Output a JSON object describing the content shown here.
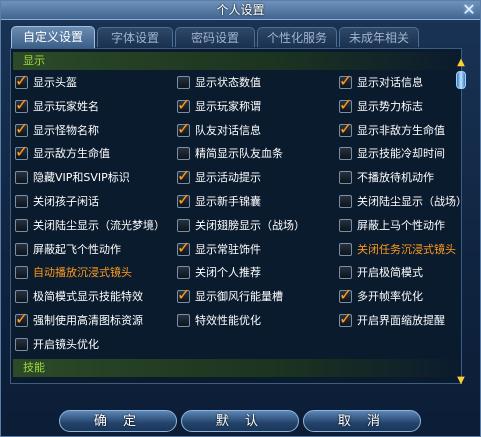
{
  "window": {
    "title": "个人设置"
  },
  "tabs": [
    "自定义设置",
    "字体设置",
    "密码设置",
    "个性化服务",
    "未成年相关"
  ],
  "sections": {
    "display": "显示",
    "skills": "技能"
  },
  "options": [
    [
      {
        "label": "显示头盔",
        "checked": true
      },
      {
        "label": "显示状态数值",
        "checked": false
      },
      {
        "label": "显示对话信息",
        "checked": true
      }
    ],
    [
      {
        "label": "显示玩家姓名",
        "checked": true
      },
      {
        "label": "显示玩家称谓",
        "checked": true
      },
      {
        "label": "显示势力标志",
        "checked": true
      }
    ],
    [
      {
        "label": "显示怪物名称",
        "checked": true
      },
      {
        "label": "队友对话信息",
        "checked": true
      },
      {
        "label": "显示非敌方生命值",
        "checked": true
      }
    ],
    [
      {
        "label": "显示敌方生命值",
        "checked": true
      },
      {
        "label": "精简显示队友血条",
        "checked": false
      },
      {
        "label": "显示技能冷却时间",
        "checked": false
      }
    ],
    [
      {
        "label": "隐藏VIP和SVIP标识",
        "checked": false
      },
      {
        "label": "显示活动提示",
        "checked": true
      },
      {
        "label": "不播放待机动作",
        "checked": false
      }
    ],
    [
      {
        "label": "关闭孩子闲话",
        "checked": false
      },
      {
        "label": "显示新手锦囊",
        "checked": true
      },
      {
        "label": "关闭陆尘显示（战场）",
        "checked": false
      }
    ],
    [
      {
        "label": "关闭陆尘显示（流光梦境）",
        "checked": false
      },
      {
        "label": "关闭翅膀显示（战场）",
        "checked": false
      },
      {
        "label": "屏蔽上马个性动作",
        "checked": false
      }
    ],
    [
      {
        "label": "屏蔽起飞个性动作",
        "checked": false
      },
      {
        "label": "显示常驻饰件",
        "checked": true
      },
      {
        "label": "关闭任务沉浸式镜头",
        "checked": false,
        "highlight": true
      }
    ],
    [
      {
        "label": "自动播放沉浸式镜头",
        "checked": false,
        "highlight": true
      },
      {
        "label": "关闭个人推荐",
        "checked": false
      },
      {
        "label": "开启极简模式",
        "checked": false
      }
    ],
    [
      {
        "label": "极简模式显示技能特效",
        "checked": false
      },
      {
        "label": "显示御风行能量槽",
        "checked": true
      },
      {
        "label": "多开帧率优化",
        "checked": true
      }
    ],
    [
      {
        "label": "强制使用高清图标资源",
        "checked": true
      },
      {
        "label": "特效性能优化",
        "checked": false
      },
      {
        "label": "开启界面缩放提醒",
        "checked": true
      }
    ],
    [
      {
        "label": "开启镜头优化",
        "checked": false
      }
    ]
  ],
  "buttons": {
    "ok": "确 定",
    "default": "默 认",
    "cancel": "取 消"
  },
  "colors": {
    "checkmark": "#ff9d1e",
    "highlight_text": "#ff9a1a",
    "section_text": "#9fdc3c"
  }
}
